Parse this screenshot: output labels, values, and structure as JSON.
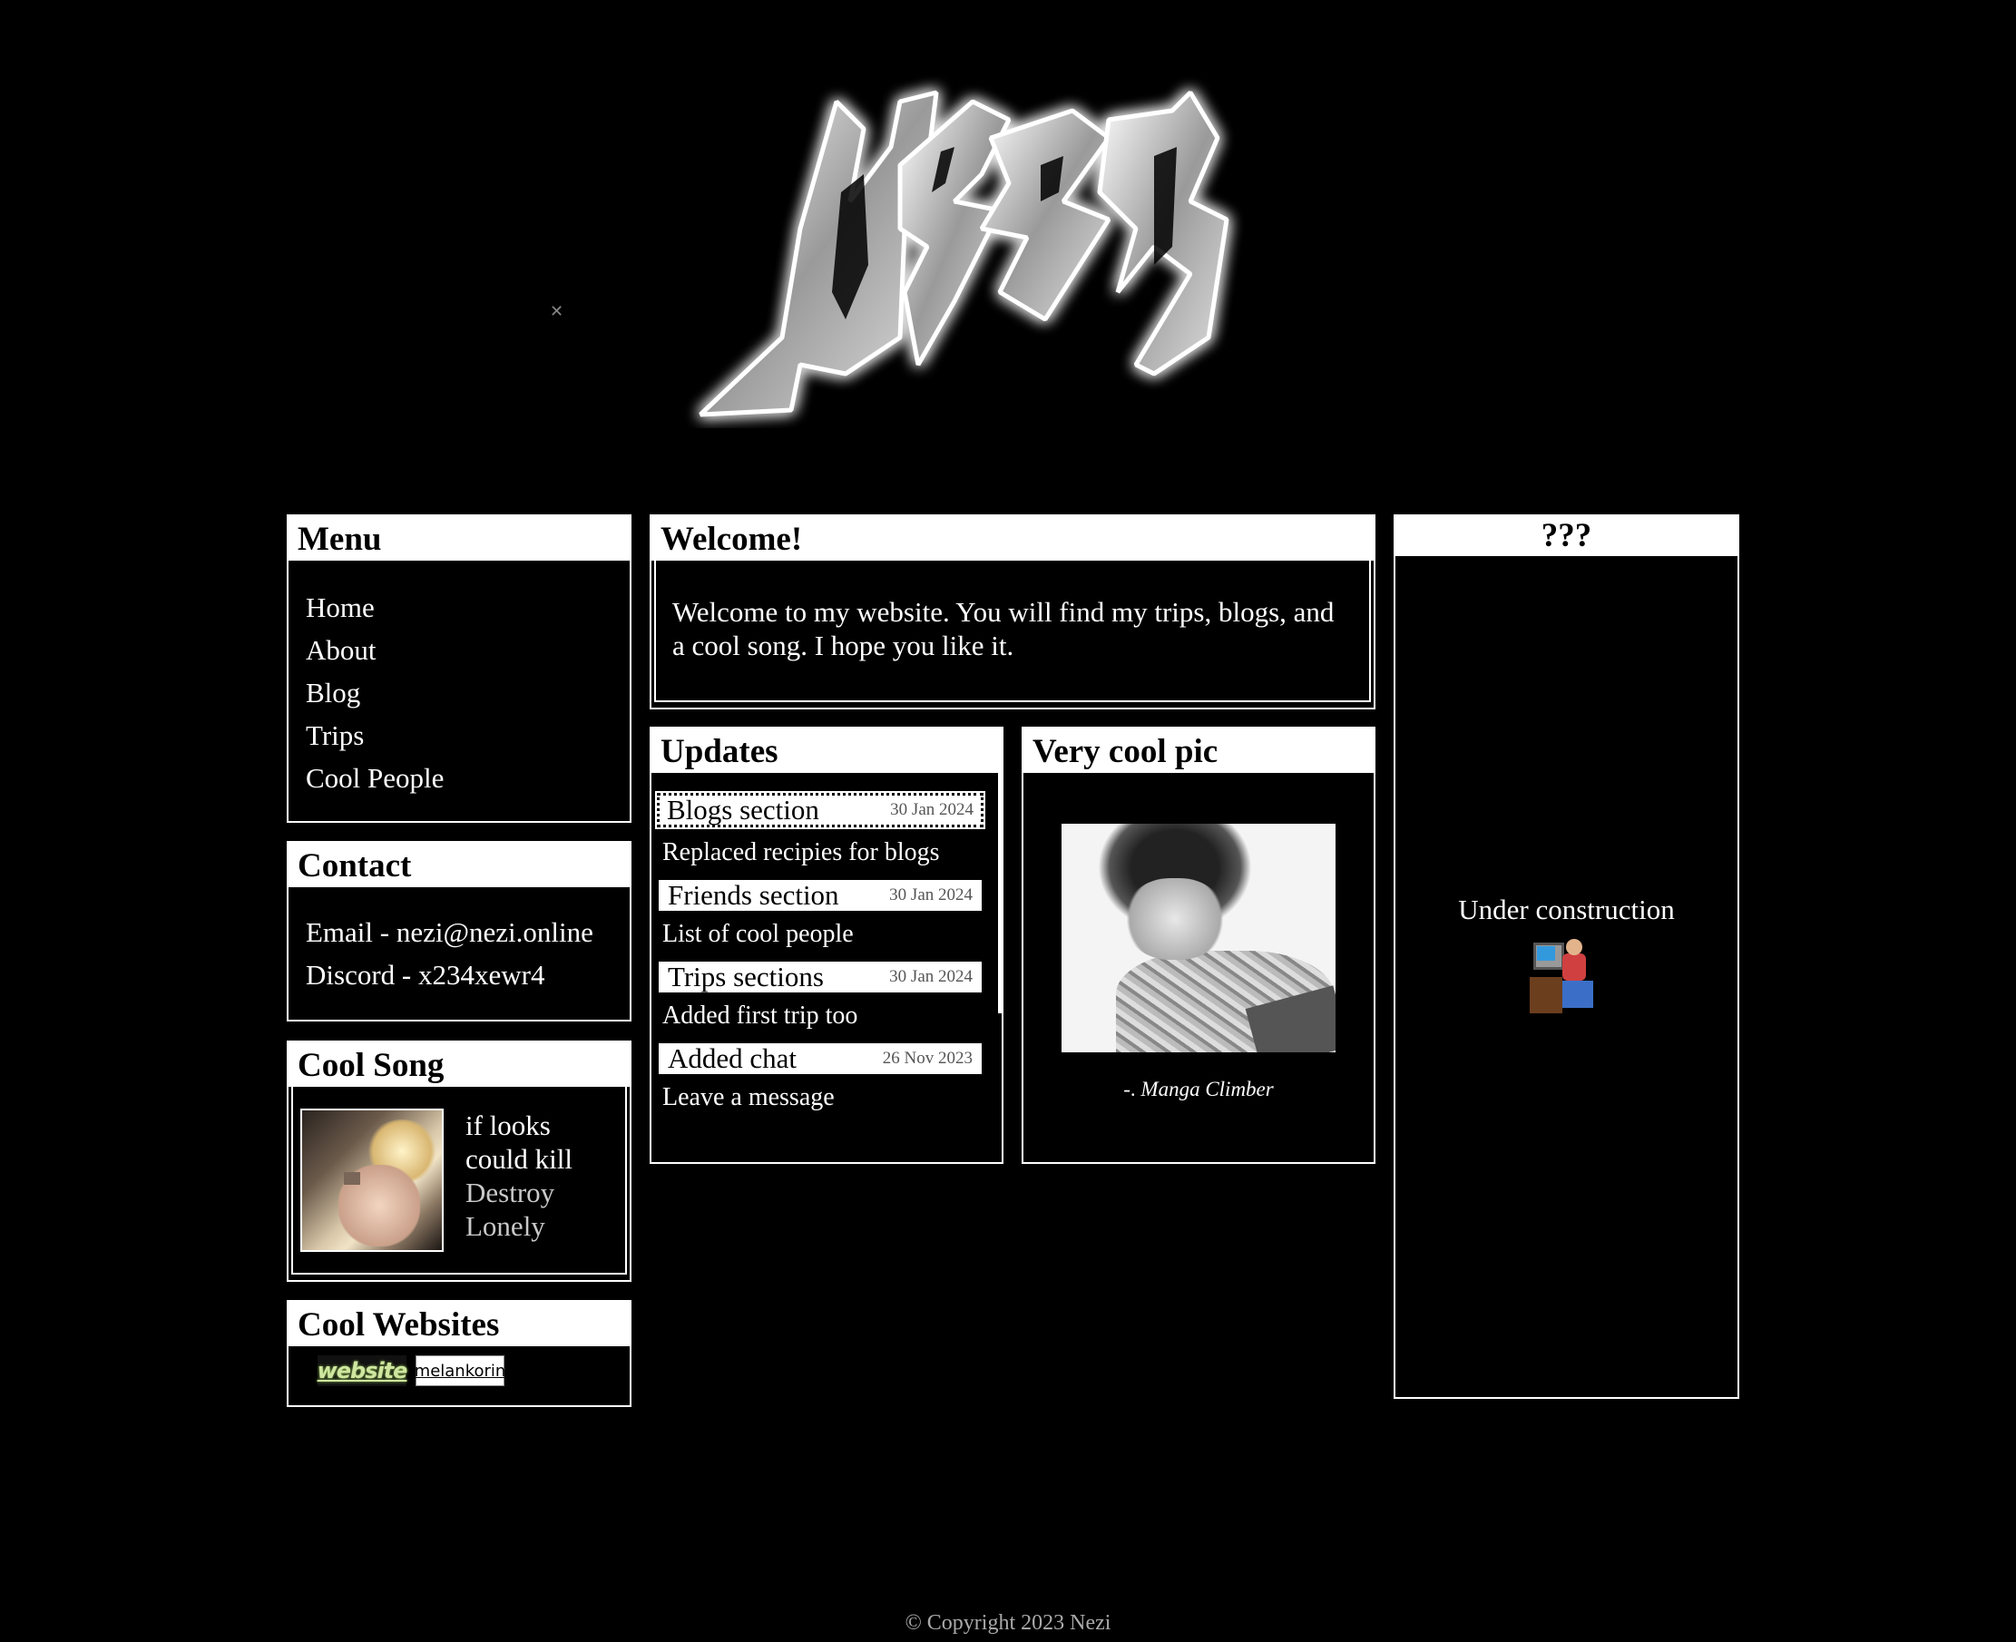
{
  "menu": {
    "title": "Menu",
    "items": [
      {
        "label": "Home"
      },
      {
        "label": "About"
      },
      {
        "label": "Blog"
      },
      {
        "label": "Trips"
      },
      {
        "label": "Cool People"
      }
    ]
  },
  "contact": {
    "title": "Contact",
    "email": "Email - nezi@nezi.online",
    "discord": "Discord - x234xewr4"
  },
  "song": {
    "title": "Cool Song",
    "track_line1": "if looks",
    "track_line2": "could kill",
    "artist_line1": "Destroy",
    "artist_line2": "Lonely"
  },
  "websites": {
    "title": "Cool Websites",
    "button1": "website",
    "button2": "melankorin"
  },
  "welcome": {
    "title": "Welcome!",
    "text": "Welcome to my website. You will find my trips, blogs, and a cool song. I hope you like it."
  },
  "updates": {
    "title": "Updates",
    "items": [
      {
        "title": "Blogs section",
        "date": "30 Jan 2024",
        "desc": "Replaced recipies for blogs"
      },
      {
        "title": "Friends section",
        "date": "30 Jan 2024",
        "desc": "List of cool people"
      },
      {
        "title": "Trips sections",
        "date": "30 Jan 2024",
        "desc": "Added first trip too"
      },
      {
        "title": "Added chat",
        "date": "26 Nov 2023",
        "desc": "Leave a message"
      }
    ]
  },
  "pic": {
    "title": "Very cool pic",
    "caption_prefix": "-. ",
    "caption": "Manga Climber"
  },
  "mystery": {
    "title": "???",
    "text": "Under construction"
  },
  "footer": "© Copyright 2023 Nezi",
  "colors": {
    "background": "#000000",
    "foreground": "#ffffff"
  }
}
